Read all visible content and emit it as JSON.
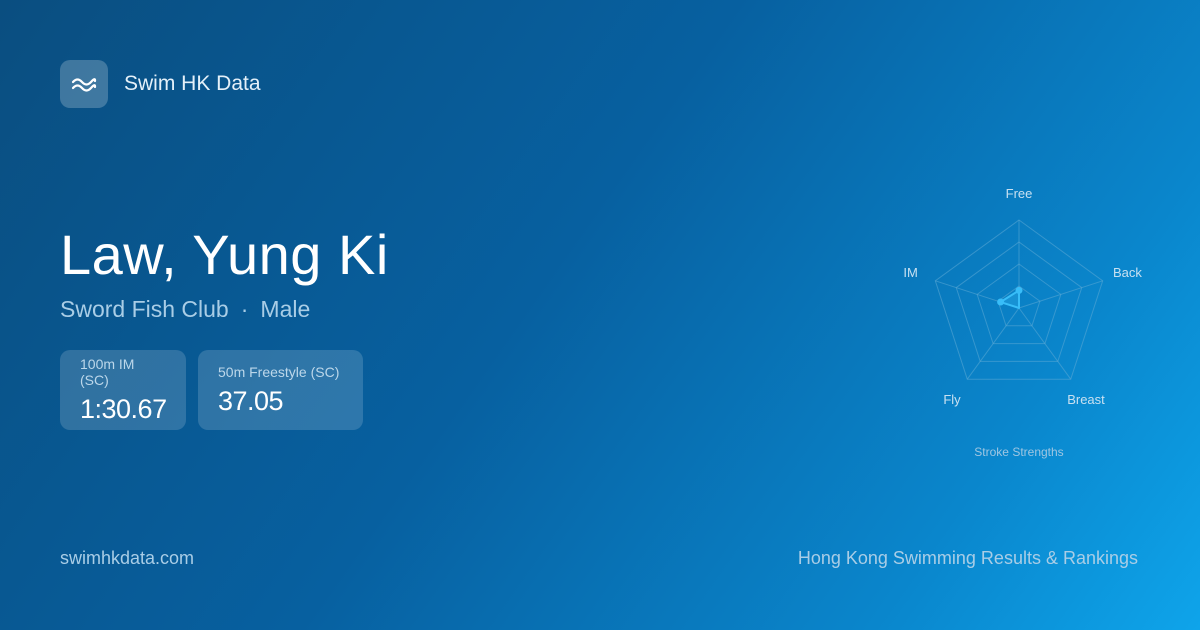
{
  "brand": {
    "name": "Swim HK Data",
    "icon": "waves-icon"
  },
  "swimmer": {
    "name": "Law, Yung Ki",
    "club": "Sword Fish Club",
    "separator": "·",
    "gender": "Male"
  },
  "stats": [
    {
      "label": "100m IM (SC)",
      "value": "1:30.67"
    },
    {
      "label": "50m Freestyle (SC)",
      "value": "37.05"
    }
  ],
  "chart_data": {
    "type": "radar",
    "title": "Stroke Strengths",
    "axes": [
      "Free",
      "Back",
      "Breast",
      "Fly",
      "IM"
    ],
    "values": [
      0.2,
      0.0,
      0.0,
      0.0,
      0.22
    ],
    "range": [
      0,
      1
    ],
    "rings": 4,
    "colors": {
      "grid": "#5da9d6",
      "series": "#38bdf8"
    }
  },
  "footer": {
    "url": "swimhkdata.com",
    "tagline": "Hong Kong Swimming Results & Rankings"
  }
}
